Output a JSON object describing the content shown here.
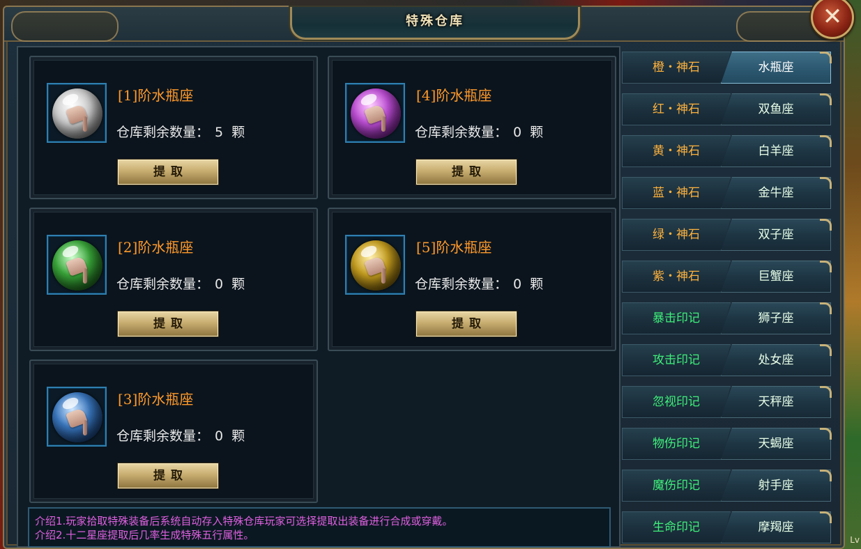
{
  "window": {
    "title": "特殊仓库",
    "close_symbol": "✕"
  },
  "slots": [
    {
      "name": "[1]阶水瓶座",
      "count_label": "仓库剩余数量：",
      "count": "5",
      "unit": "颗",
      "button": "提取",
      "orb_color": "#c8c8c8",
      "orb_icon": "silver-orb-icon"
    },
    {
      "name": "[2]阶水瓶座",
      "count_label": "仓库剩余数量：",
      "count": "0",
      "unit": "颗",
      "button": "提取",
      "orb_color": "#3aa83a",
      "orb_icon": "green-orb-icon"
    },
    {
      "name": "[3]阶水瓶座",
      "count_label": "仓库剩余数量：",
      "count": "0",
      "unit": "颗",
      "button": "提取",
      "orb_color": "#3a78c0",
      "orb_icon": "blue-orb-icon"
    },
    {
      "name": "[4]阶水瓶座",
      "count_label": "仓库剩余数量：",
      "count": "0",
      "unit": "颗",
      "button": "提取",
      "orb_color": "#b040c8",
      "orb_icon": "purple-orb-icon"
    },
    {
      "name": "[5]阶水瓶座",
      "count_label": "仓库剩余数量：",
      "count": "0",
      "unit": "颗",
      "button": "提取",
      "orb_color": "#c8a020",
      "orb_icon": "gold-orb-icon"
    }
  ],
  "intro": [
    "介绍1.玩家拾取特殊装备后系统自动存入特殊仓库玩家可选择提取出装备进行合成或穿戴。",
    "介绍2.十二星座提取后几率生成特殊五行属性。"
  ],
  "tabs": [
    {
      "left": "橙・神石",
      "right": "水瓶座",
      "left_color": "orange",
      "active": true
    },
    {
      "left": "红・神石",
      "right": "双鱼座",
      "left_color": "orange",
      "active": false
    },
    {
      "left": "黄・神石",
      "right": "白羊座",
      "left_color": "orange",
      "active": false
    },
    {
      "left": "蓝・神石",
      "right": "金牛座",
      "left_color": "orange",
      "active": false
    },
    {
      "left": "绿・神石",
      "right": "双子座",
      "left_color": "orange",
      "active": false
    },
    {
      "left": "紫・神石",
      "right": "巨蟹座",
      "left_color": "orange",
      "active": false
    },
    {
      "left": "暴击印记",
      "right": "狮子座",
      "left_color": "green",
      "active": false
    },
    {
      "left": "攻击印记",
      "right": "处女座",
      "left_color": "green",
      "active": false
    },
    {
      "left": "忽视印记",
      "right": "天秤座",
      "left_color": "green",
      "active": false
    },
    {
      "left": "物伤印记",
      "right": "天蝎座",
      "left_color": "green",
      "active": false
    },
    {
      "left": "魔伤印记",
      "right": "射手座",
      "left_color": "green",
      "active": false
    },
    {
      "left": "生命印记",
      "right": "摩羯座",
      "left_color": "green",
      "active": false
    }
  ],
  "background": {
    "corner_label": "Lv"
  },
  "colors": {
    "slot_name": "#ff9a2a",
    "intro_text": "#e060e0",
    "tab_orange": "#ffb23c",
    "tab_green": "#3ef07a",
    "frame_gold": "#8a7650"
  }
}
